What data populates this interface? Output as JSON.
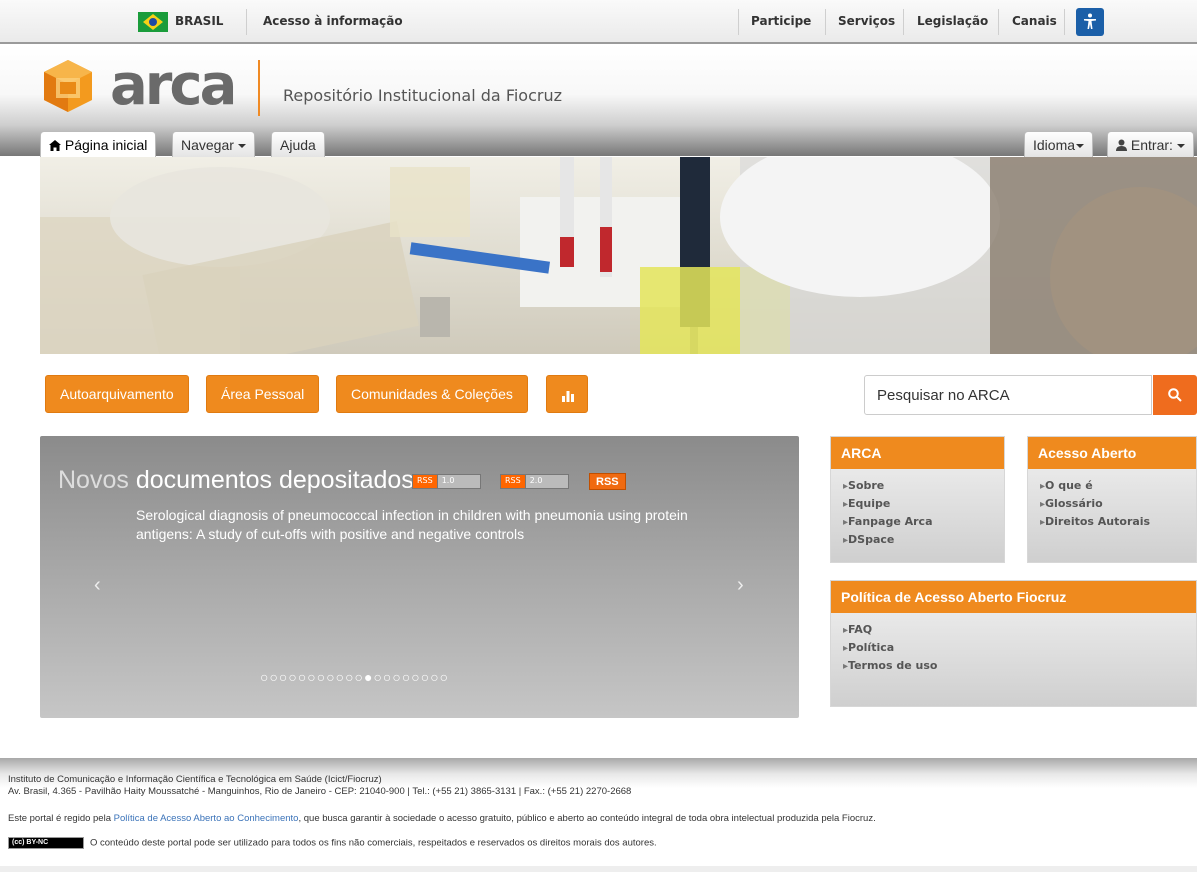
{
  "gov": {
    "country": "BRASIL",
    "access": "Acesso à informação",
    "links": [
      "Participe",
      "Serviços",
      "Legislação",
      "Canais"
    ]
  },
  "header": {
    "logo_text": "arca",
    "subtitle": "Repositório Institucional da Fiocruz"
  },
  "nav": {
    "home": "Página inicial",
    "browse": "Navegar",
    "help": "Ajuda",
    "language": "Idioma",
    "login": "Entrar:"
  },
  "actions": {
    "self_archive": "Autoarquivamento",
    "personal_area": "Área Pessoal",
    "communities": "Comunidades & Coleções",
    "search_placeholder": "Pesquisar no ARCA"
  },
  "carousel": {
    "title_prefix": "Novos",
    "title_rest": " documentos depositados",
    "rss1_a": "RSS",
    "rss1_b": "1.0",
    "rss2_a": "RSS",
    "rss2_b": "2.0",
    "rss_big": "RSS",
    "text": "Serological diagnosis of pneumococcal infection in children with pneumonia using protein antigens: A study of cut-offs with positive and negative controls",
    "prev": "‹",
    "next": "›",
    "dots": "○○○○○○○○○○○●○○○○○○○○",
    "active_slide": 12,
    "total_slides": 20
  },
  "box_arca": {
    "title": "ARCA",
    "items": [
      "Sobre",
      "Equipe",
      "Fanpage Arca",
      "DSpace"
    ]
  },
  "box_open": {
    "title": "Acesso Aberto",
    "items": [
      "O que é",
      "Glossário",
      "Direitos Autorais"
    ]
  },
  "box_policy": {
    "title": "Política de Acesso Aberto Fiocruz",
    "items": [
      "FAQ",
      "Política",
      "Termos de uso"
    ]
  },
  "footer": {
    "line1": "Instituto de Comunicação e Informação Científica e Tecnológica em Saúde (Icict/Fiocruz)",
    "line2": "Av. Brasil, 4.365 - Pavilhão Haity Moussatché - Manguinhos, Rio de Janeiro - CEP: 21040-900 | Tel.: (+55 21) 3865-3131 | Fax.: (+55 21) 2270-2668",
    "line3_pre": "Este portal é regido pela ",
    "line3_link": "Política de Acesso Aberto ao Conhecimento",
    "line3_post": ", que busca garantir à sociedade o acesso gratuito, público e aberto ao conteúdo integral de toda obra intelectual produzida pela Fiocruz.",
    "cc_label": "(cc) BY-NC",
    "line4": "O conteúdo deste portal pode ser utilizado para todos os fins não comerciais, respeitados e reservados os direitos morais dos autores."
  },
  "colors": {
    "accent": "#ef8a1e",
    "search_button": "#ef6c1e",
    "link": "#3b73b9"
  }
}
